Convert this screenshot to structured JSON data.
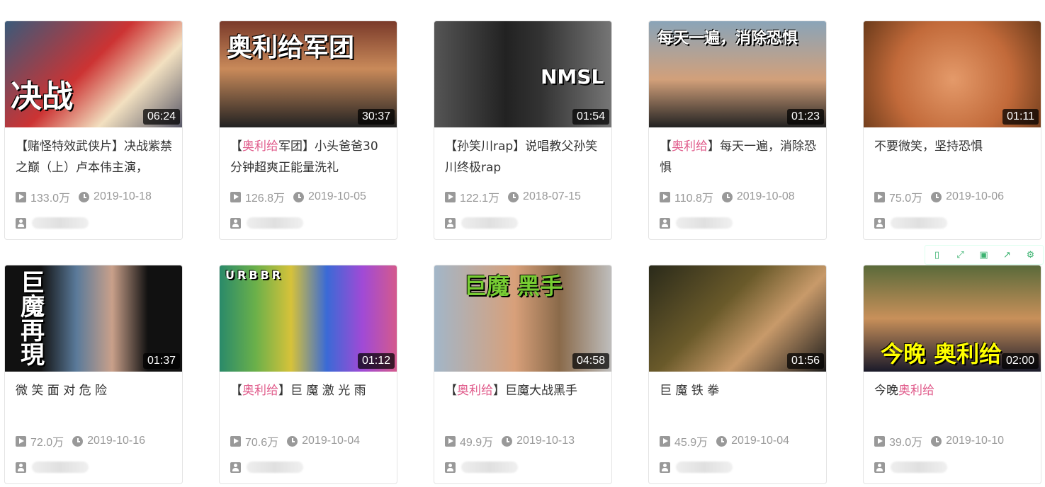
{
  "videos": [
    {
      "title_pre": "【赌怪特效武侠片】决战紫禁之巅（上）卢本伟主演，",
      "title_hl": "",
      "title_post": "",
      "views": "133.0万",
      "date": "2019-10-18",
      "duration": "06:24",
      "thumb_text": "决战"
    },
    {
      "title_pre": "【",
      "title_hl": "奥利给",
      "title_post": "军团】小头爸爸30分钟超爽正能量洗礼",
      "views": "126.8万",
      "date": "2019-10-05",
      "duration": "30:37",
      "thumb_text": "奥利给军团"
    },
    {
      "title_pre": "【孙笑川rap】说唱教父孙笑川终极rap",
      "title_hl": "",
      "title_post": "",
      "views": "122.1万",
      "date": "2018-07-15",
      "duration": "01:54",
      "thumb_text": "NMSL"
    },
    {
      "title_pre": "【",
      "title_hl": "奥利给",
      "title_post": "】每天一遍，消除恐惧",
      "views": "110.8万",
      "date": "2019-10-08",
      "duration": "01:23",
      "thumb_text": "每天一遍，消除恐惧"
    },
    {
      "title_pre": "不要微笑，坚持恐惧",
      "title_hl": "",
      "title_post": "",
      "views": "75.0万",
      "date": "2019-10-06",
      "duration": "01:11",
      "thumb_text": ""
    },
    {
      "title_pre": "微 笑 面 对 危 险",
      "title_hl": "",
      "title_post": "",
      "views": "72.0万",
      "date": "2019-10-16",
      "duration": "01:37",
      "thumb_text": "巨魔再現"
    },
    {
      "title_pre": "【",
      "title_hl": "奥利给",
      "title_post": "】巨 魔 激 光 雨",
      "views": "70.6万",
      "date": "2019-10-04",
      "duration": "01:12",
      "thumb_text": "URBBR"
    },
    {
      "title_pre": "【",
      "title_hl": "奥利给",
      "title_post": "】巨魔大战黑手",
      "views": "49.9万",
      "date": "2019-10-13",
      "duration": "04:58",
      "thumb_text": "巨魔 黑手"
    },
    {
      "title_pre": "巨 魔 铁 拳",
      "title_hl": "",
      "title_post": "",
      "views": "45.9万",
      "date": "2019-10-04",
      "duration": "01:56",
      "thumb_text": ""
    },
    {
      "title_pre": "今晚",
      "title_hl": "奥利给",
      "title_post": "",
      "views": "39.0万",
      "date": "2019-10-10",
      "duration": "02:00",
      "thumb_text": "今晚 奥利给"
    }
  ],
  "toolbar": {
    "icons": [
      "copy-icon",
      "expand-icon",
      "save-icon",
      "share-icon",
      "settings-icon"
    ]
  },
  "colors": {
    "highlight": "#e05a8a",
    "meta": "#999999",
    "toolbar": "#3cb371"
  }
}
